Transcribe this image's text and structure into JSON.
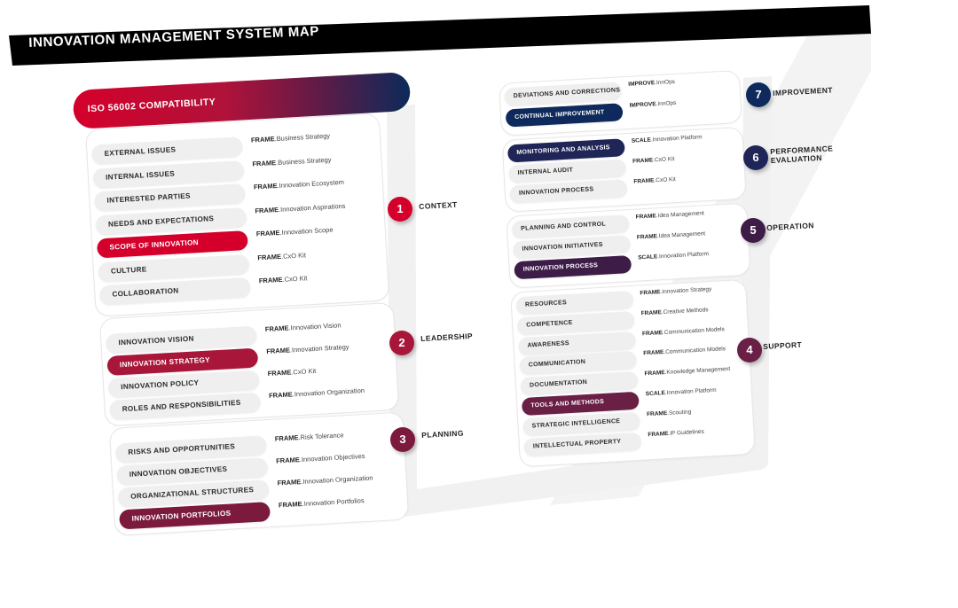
{
  "title": "INNOVATION MANAGEMENT SYSTEM MAP",
  "iso_header": "ISO 56002 COMPATIBILITY",
  "colors": {
    "banner": "#000000",
    "context_red": "#d4002b",
    "leadership_red": "#a8173a",
    "planning_maroon": "#7c1a3e",
    "support_plum": "#6a1f45",
    "operation_purple": "#3e1c48",
    "evaluation_navy": "#1f2556",
    "improvement_navy": "#0e2a5c",
    "track_gray": "#f1f1f1"
  },
  "steps": [
    {
      "number": "1",
      "label": "CONTEXT"
    },
    {
      "number": "2",
      "label": "LEADERSHIP"
    },
    {
      "number": "3",
      "label": "PLANNING"
    },
    {
      "number": "4",
      "label": "SUPPORT"
    },
    {
      "number": "5",
      "label": "OPERATION"
    },
    {
      "number": "6",
      "label": "PERFORMANCE",
      "label2": "EVALUATION"
    },
    {
      "number": "7",
      "label": "IMPROVEMENT"
    }
  ],
  "context": [
    {
      "label": "EXTERNAL ISSUES",
      "brand": "FRAME",
      "tool": ".Business Strategy",
      "highlight": false
    },
    {
      "label": "INTERNAL ISSUES",
      "brand": "FRAME",
      "tool": ".Business Strategy",
      "highlight": false
    },
    {
      "label": "INTERESTED PARTIES",
      "brand": "FRAME",
      "tool": ".Innovation Ecosystem",
      "highlight": false
    },
    {
      "label": "NEEDS AND EXPECTATIONS",
      "brand": "FRAME",
      "tool": ".Innovation Aspirations",
      "highlight": false
    },
    {
      "label": "SCOPE OF INNOVATION",
      "brand": "FRAME",
      "tool": ".Innovation Scope",
      "highlight": true
    },
    {
      "label": "CULTURE",
      "brand": "FRAME",
      "tool": ".CxO Kit",
      "highlight": false
    },
    {
      "label": "COLLABORATION",
      "brand": "FRAME",
      "tool": ".CxO Kit",
      "highlight": false
    }
  ],
  "leadership": [
    {
      "label": "INNOVATION VISION",
      "brand": "FRAME",
      "tool": ".Innovation Vision",
      "highlight": false
    },
    {
      "label": "INNOVATION STRATEGY",
      "brand": "FRAME",
      "tool": ".Innovation Strategy",
      "highlight": true
    },
    {
      "label": "INNOVATION POLICY",
      "brand": "FRAME",
      "tool": ".CxO Kit",
      "highlight": false
    },
    {
      "label": "ROLES AND RESPONSIBILITIES",
      "brand": "FRAME",
      "tool": ".Innovation Organization",
      "highlight": false
    }
  ],
  "planning": [
    {
      "label": "RISKS AND OPPORTUNITIES",
      "brand": "FRAME",
      "tool": ".Risk Tolerance",
      "highlight": false
    },
    {
      "label": "INNOVATION OBJECTIVES",
      "brand": "FRAME",
      "tool": ".Innovation Objectives",
      "highlight": false
    },
    {
      "label": "ORGANIZATIONAL STRUCTURES",
      "brand": "FRAME",
      "tool": ".Innovation Organization",
      "highlight": false
    },
    {
      "label": "INNOVATION PORTFOLIOS",
      "brand": "FRAME",
      "tool": ".Innovation Portfolios",
      "highlight": true
    }
  ],
  "improvement": [
    {
      "label": "DEVIATIONS AND CORRECTIONS",
      "brand": "IMPROVE",
      "tool": ".InnOps",
      "highlight": false
    },
    {
      "label": "CONTINUAL IMPROVEMENT",
      "brand": "IMPROVE",
      "tool": ".InnOps",
      "highlight": true
    }
  ],
  "evaluation": [
    {
      "label": "MONITORING AND ANALYSIS",
      "brand": "SCALE",
      "tool": ".Innovation Platform",
      "highlight": true
    },
    {
      "label": "INTERNAL AUDIT",
      "brand": "FRAME",
      "tool": ".CxO Kit",
      "highlight": false
    },
    {
      "label": "INNOVATION PROCESS",
      "brand": "FRAME",
      "tool": ".CxO Kit",
      "highlight": false
    }
  ],
  "operation": [
    {
      "label": "PLANNING AND CONTROL",
      "brand": "FRAME",
      "tool": ".Idea Management",
      "highlight": false
    },
    {
      "label": "INNOVATION INITIATIVES",
      "brand": "FRAME",
      "tool": ".Idea Management",
      "highlight": false
    },
    {
      "label": "INNOVATION PROCESS",
      "brand": "SCALE",
      "tool": ".Innovation Platform",
      "highlight": true
    }
  ],
  "support": [
    {
      "label": "RESOURCES",
      "brand": "FRAME",
      "tool": ".Innovation Strategy",
      "highlight": false
    },
    {
      "label": "COMPETENCE",
      "brand": "FRAME",
      "tool": ".Creative Methods",
      "highlight": false
    },
    {
      "label": "AWARENESS",
      "brand": "FRAME",
      "tool": ".Communication Models",
      "highlight": false
    },
    {
      "label": "COMMUNICATION",
      "brand": "FRAME",
      "tool": ".Communication Models",
      "highlight": false
    },
    {
      "label": "DOCUMENTATION",
      "brand": "FRAME",
      "tool": ".Knowledge Management",
      "highlight": false
    },
    {
      "label": "TOOLS AND METHODS",
      "brand": "SCALE",
      "tool": ".Innovation Platform",
      "highlight": true
    },
    {
      "label": "STRATEGIC INTELLIGENCE",
      "brand": "FRAME",
      "tool": ".Scouting",
      "highlight": false
    },
    {
      "label": "INTELLECTUAL PROPERTY",
      "brand": "FRAME",
      "tool": ".IP Guidelines",
      "highlight": false
    }
  ]
}
